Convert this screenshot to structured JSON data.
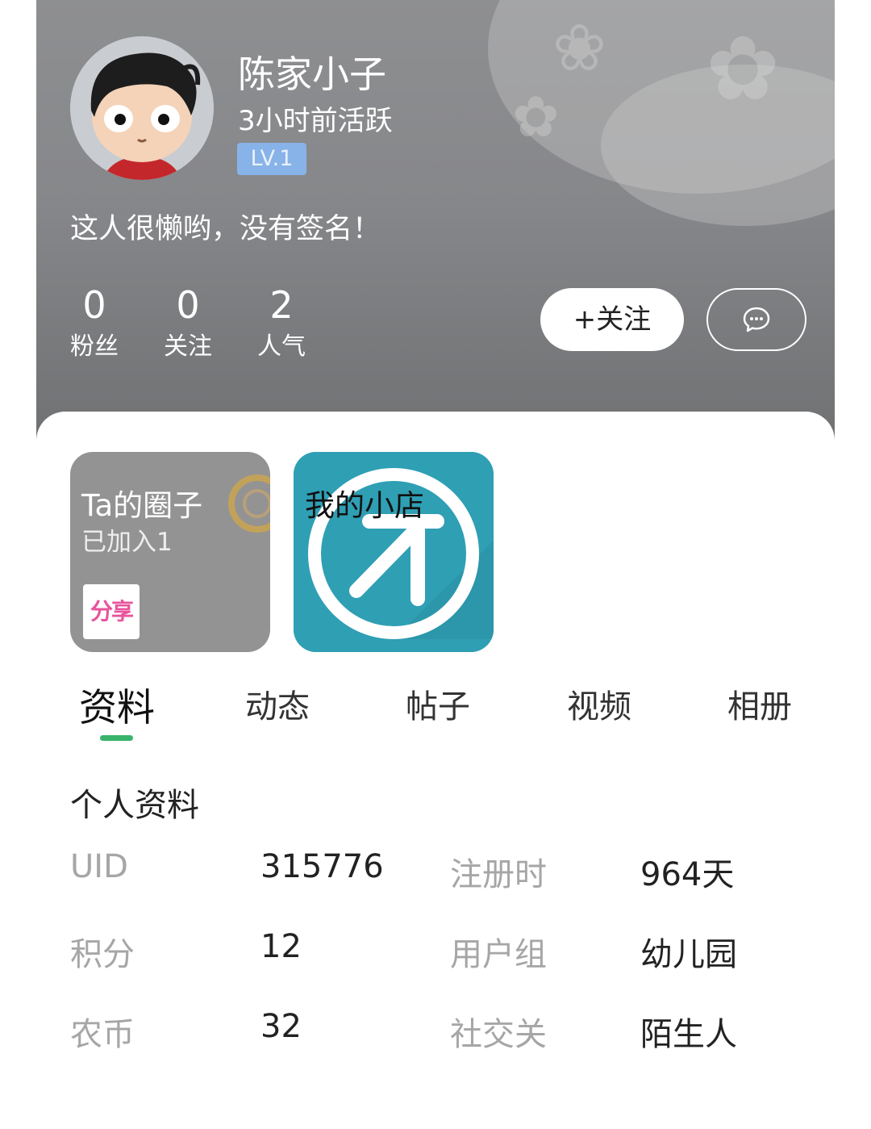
{
  "profile": {
    "name": "陈家小子",
    "active_time": "3小时前活跃",
    "level": "LV.1",
    "signature": "这人很懒哟，没有签名！"
  },
  "stats": [
    {
      "value": "0",
      "label": "粉丝"
    },
    {
      "value": "0",
      "label": "关注"
    },
    {
      "value": "2",
      "label": "人气"
    }
  ],
  "actions": {
    "follow_label": "+关注",
    "message_icon": "chat-bubble-icon"
  },
  "cards": {
    "circle": {
      "title": "Ta的圈子",
      "subtitle": "已加入1",
      "thumb_text": "分享"
    },
    "shop": {
      "title": "我的小店"
    }
  },
  "tabs": [
    {
      "label": "资料",
      "active": true
    },
    {
      "label": "动态",
      "active": false
    },
    {
      "label": "帖子",
      "active": false
    },
    {
      "label": "视频",
      "active": false
    },
    {
      "label": "相册",
      "active": false
    }
  ],
  "info": {
    "section_title": "个人资料",
    "rows": [
      {
        "label1": "UID",
        "value1": "315776",
        "label2": "注册时",
        "value2": "964天"
      },
      {
        "label1": "积分",
        "value1": "12",
        "label2": "用户组",
        "value2": "幼儿园"
      },
      {
        "label1": "农币",
        "value1": "32",
        "label2": "社交关",
        "value2": "陌生人"
      }
    ]
  },
  "colors": {
    "accent_green": "#3ab36b",
    "level_badge": "#88b3e8",
    "shop_icon": "#2f9fb4"
  }
}
